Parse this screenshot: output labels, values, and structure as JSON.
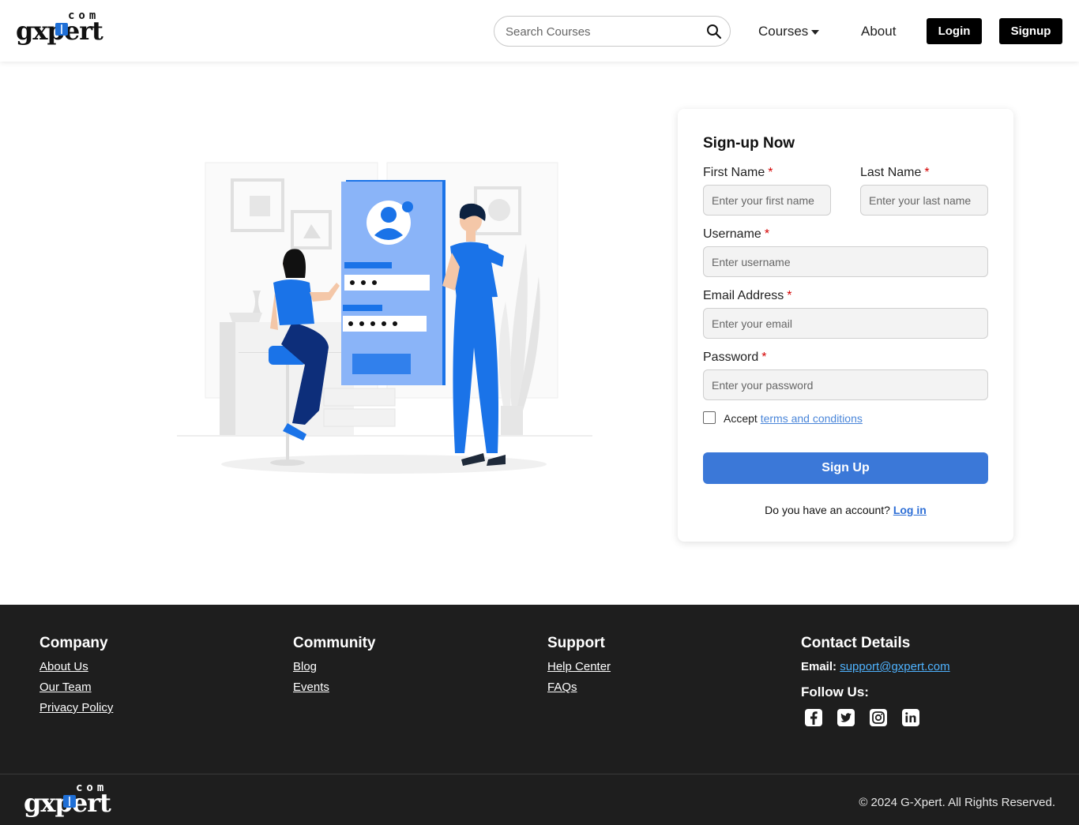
{
  "header": {
    "logo_text": "gxpert",
    "logo_suffix": "com",
    "search_placeholder": "Search Courses",
    "nav_courses": "Courses",
    "nav_about": "About",
    "login_label": "Login",
    "signup_label": "Signup"
  },
  "form": {
    "title": "Sign-up Now",
    "first_name_label": "First Name",
    "first_name_placeholder": "Enter your first name",
    "last_name_label": "Last Name",
    "last_name_placeholder": "Enter your last name",
    "username_label": "Username",
    "username_placeholder": "Enter username",
    "email_label": "Email Address",
    "email_placeholder": "Enter your email",
    "password_label": "Password",
    "password_placeholder": "Enter your password",
    "required_mark": "*",
    "accept_text": "Accept",
    "terms_link": "terms and conditions",
    "submit_label": "Sign Up",
    "login_prompt": "Do you have an account?",
    "login_link": "Log in"
  },
  "footer": {
    "company_title": "Company",
    "company_links": [
      "About Us",
      "Our Team",
      "Privacy Policy"
    ],
    "community_title": "Community",
    "community_links": [
      "Blog",
      "Events"
    ],
    "support_title": "Support",
    "support_links": [
      "Help Center",
      "FAQs"
    ],
    "contact_title": "Contact Details",
    "email_label": "Email:",
    "email_value": "support@gxpert.com",
    "follow_label": "Follow Us:",
    "socials": [
      "facebook-icon",
      "twitter-icon",
      "instagram-icon",
      "linkedin-icon"
    ],
    "copyright": "© 2024 G-Xpert. All Rights Reserved."
  },
  "colors": {
    "accent": "#3b78d8",
    "illustration_blue": "#1a73e8",
    "footer_bg": "#1e1e1e",
    "required": "#d40000"
  }
}
